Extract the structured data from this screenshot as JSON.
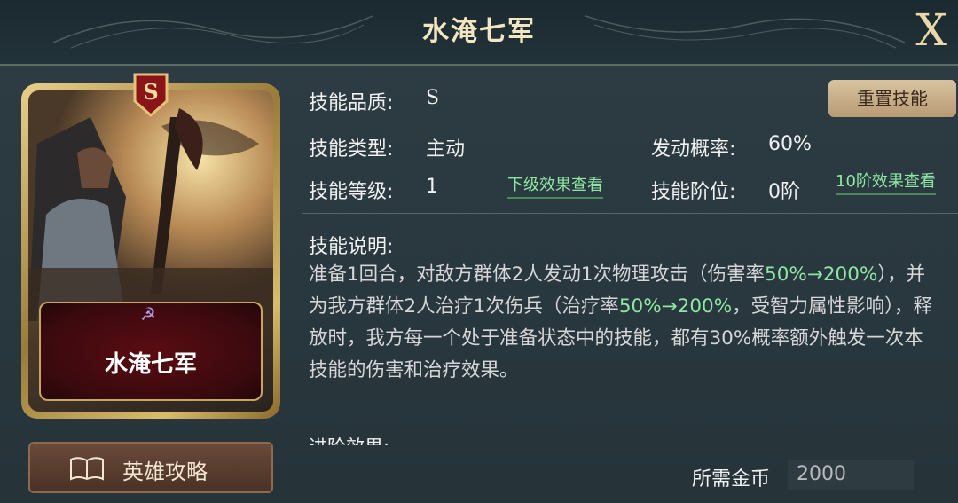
{
  "header": {
    "title": "水淹七军",
    "close_label": "X"
  },
  "card": {
    "grade_badge": "S",
    "name": "水淹七军"
  },
  "guide_button": {
    "label": "英雄攻略"
  },
  "skill": {
    "quality_label": "技能品质:",
    "quality_value": "S",
    "type_label": "技能类型:",
    "type_value": "主动",
    "chance_label": "发动概率:",
    "chance_value": "60%",
    "level_label": "技能等级:",
    "level_value": "1",
    "next_level_link": "下级效果查看",
    "tier_label": "技能阶位:",
    "tier_value": "0阶",
    "tier10_link": "10阶效果查看",
    "reset_button": "重置技能"
  },
  "description": {
    "title": "技能说明:",
    "p1": "准备1回合，对敌方群体2人发动1次物理攻击（伤害率",
    "h1": "50%→200%",
    "p2": "），并为我方群体2人治疗1次伤兵（治疗率",
    "h2": "50%→200%",
    "p3": "，受智力属性影响），释放时，我方每一个处于准备状态中的技能，都有30%概率额外触发一次本技能的伤害和治疗效果。"
  },
  "advance": {
    "title": "进阶效果:"
  },
  "cost": {
    "label": "所需金币",
    "value": "2000"
  }
}
